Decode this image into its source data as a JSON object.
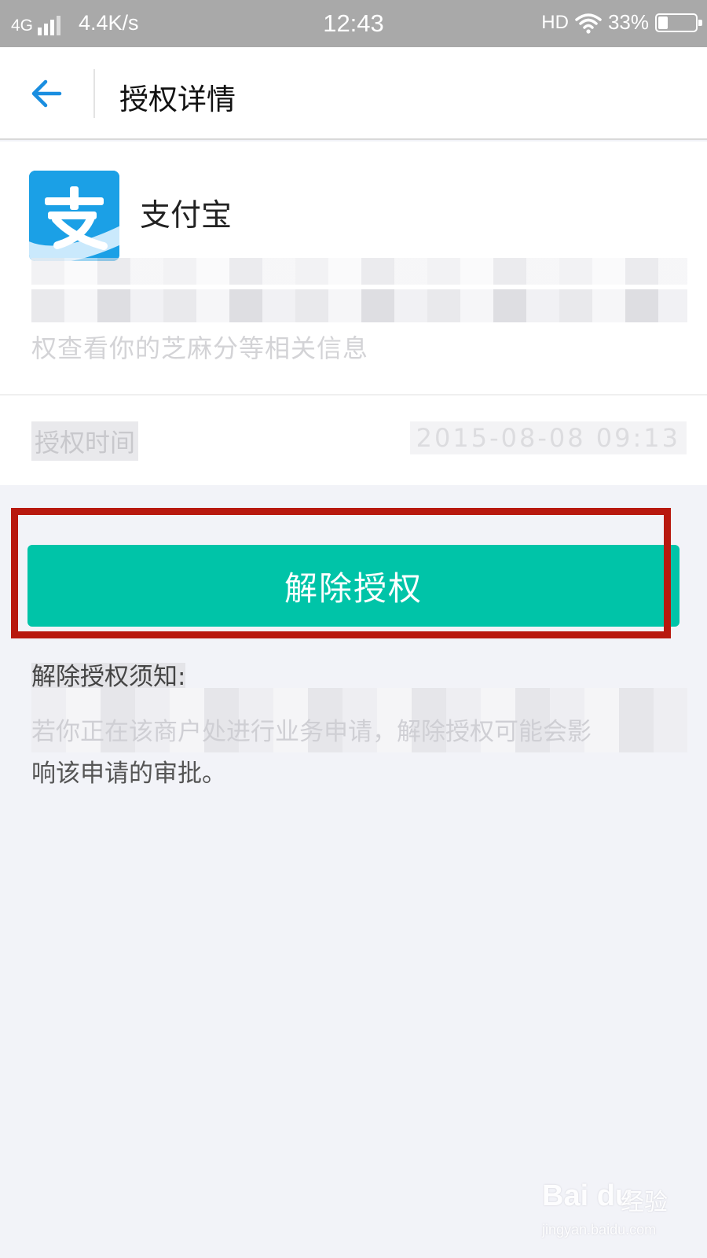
{
  "status_bar": {
    "network": "4G",
    "speed": "4.4K/s",
    "time": "12:43",
    "hd": "HD",
    "battery": "33%"
  },
  "nav": {
    "back_icon": "arrow-left-icon",
    "title": "授权详情"
  },
  "app": {
    "logo_icon": "alipay-logo",
    "name": "支付宝",
    "description_visible": "权查看你的芝麻分等相关信息",
    "auth_time_label": "授权时间",
    "auth_time_value": "2015-08-08 09:13"
  },
  "revoke_button": {
    "label": "解除授权"
  },
  "notice": {
    "title": "解除授权须知:",
    "line1": "若你正在该商户处进行业务申请，解除授权可能会影",
    "line2": "响该申请的审批。"
  },
  "watermark": {
    "logo": "Bai du",
    "brand": "经验",
    "url": "jingyan.baidu.com"
  },
  "colors": {
    "status_bar": "#a9a9a9",
    "accent_back": "#1a8ee0",
    "button": "#00c4a8",
    "highlight": "#b8190f",
    "background": "#f2f3f8"
  }
}
